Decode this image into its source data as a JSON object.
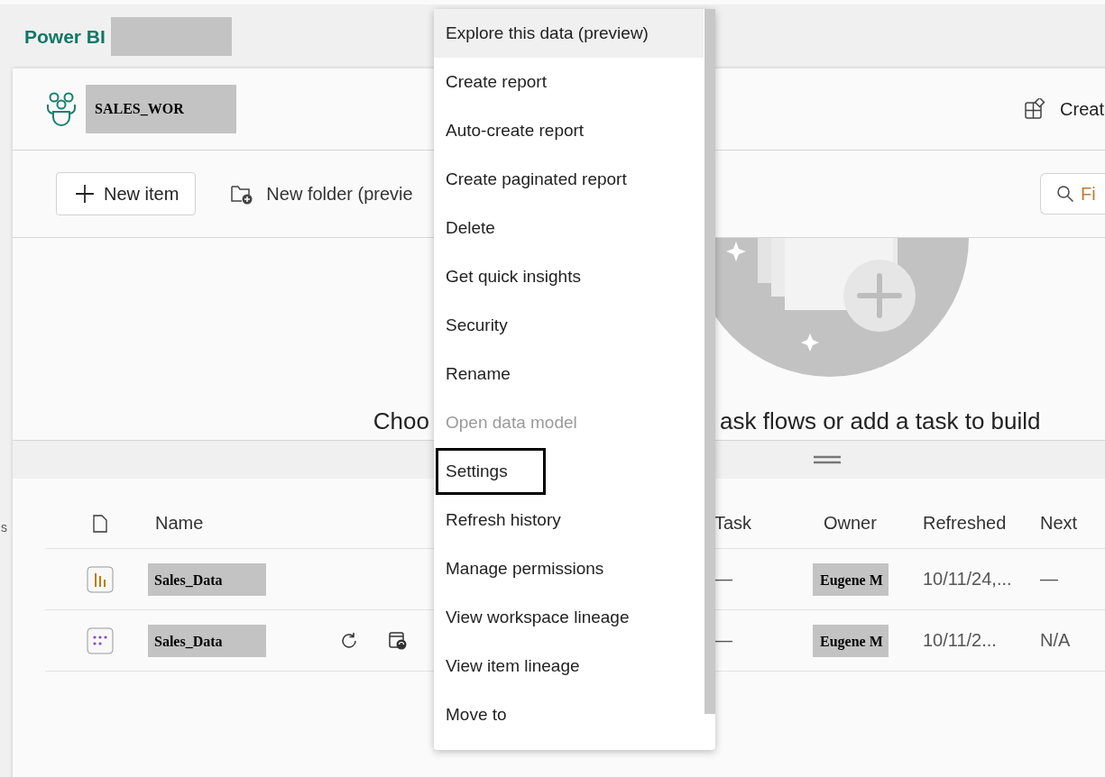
{
  "app": {
    "title": "Power BI",
    "tenant_redacted": true
  },
  "workspace": {
    "name": "SALES_WOR",
    "create_label": "Creat"
  },
  "toolbar": {
    "new_item": "New item",
    "new_folder": "New folder (previe",
    "search_placeholder": "Fi"
  },
  "empty_state": {
    "heading_left": "Choo",
    "heading_right": "ask flows or add a task to build"
  },
  "edge_text": "s",
  "table": {
    "columns": [
      "Name",
      "Task",
      "Owner",
      "Refreshed",
      "Next"
    ],
    "rows": [
      {
        "kind": "report",
        "name": "Sales_Data",
        "actions": false,
        "task": "—",
        "owner": "Eugene M",
        "refreshed": "10/11/24,...",
        "next": "—"
      },
      {
        "kind": "model",
        "name": "Sales_Data",
        "actions": true,
        "task": "—",
        "owner": "Eugene M",
        "refreshed": "10/11/2...",
        "next": "N/A"
      }
    ]
  },
  "context_menu": {
    "items": [
      {
        "label": "Explore this data (preview)",
        "selected": true,
        "disabled": false,
        "outlined": false
      },
      {
        "label": "Create report",
        "selected": false,
        "disabled": false,
        "outlined": false
      },
      {
        "label": "Auto-create report",
        "selected": false,
        "disabled": false,
        "outlined": false
      },
      {
        "label": "Create paginated report",
        "selected": false,
        "disabled": false,
        "outlined": false
      },
      {
        "label": "Delete",
        "selected": false,
        "disabled": false,
        "outlined": false
      },
      {
        "label": "Get quick insights",
        "selected": false,
        "disabled": false,
        "outlined": false
      },
      {
        "label": "Security",
        "selected": false,
        "disabled": false,
        "outlined": false
      },
      {
        "label": "Rename",
        "selected": false,
        "disabled": false,
        "outlined": false
      },
      {
        "label": "Open data model",
        "selected": false,
        "disabled": true,
        "outlined": false
      },
      {
        "label": "Settings",
        "selected": false,
        "disabled": false,
        "outlined": true
      },
      {
        "label": "Refresh history",
        "selected": false,
        "disabled": false,
        "outlined": false
      },
      {
        "label": "Manage permissions",
        "selected": false,
        "disabled": false,
        "outlined": false
      },
      {
        "label": "View workspace lineage",
        "selected": false,
        "disabled": false,
        "outlined": false
      },
      {
        "label": "View item lineage",
        "selected": false,
        "disabled": false,
        "outlined": false
      },
      {
        "label": "Move to",
        "selected": false,
        "disabled": false,
        "outlined": false
      }
    ]
  }
}
